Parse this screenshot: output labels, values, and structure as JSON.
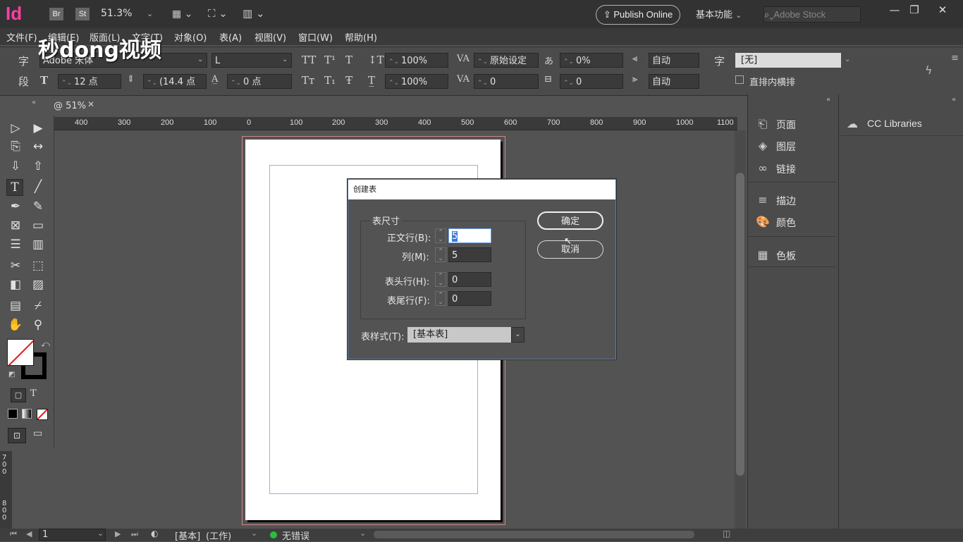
{
  "app": {
    "logo": "Id",
    "bridge_label": "Br",
    "stock_label": "St",
    "zoom": "51.3%",
    "publish_label": "Publish Online",
    "workspace": "基本功能",
    "search_placeholder": "Adobe Stock"
  },
  "menu": [
    "文件(F)",
    "编辑(E)",
    "版面(L)",
    "文字(T)",
    "对象(O)",
    "表(A)",
    "视图(V)",
    "窗口(W)",
    "帮助(H)"
  ],
  "control": {
    "char_label": "字",
    "para_label": "段",
    "font_family": "Adobe 宋体",
    "font_style": "L",
    "font_size": "12 点",
    "leading": "(14.4 点",
    "kerning": "0 点",
    "vscale": "100%",
    "hscale": "100%",
    "tracking_mode": "原始设定",
    "tracking": "0",
    "tsume": "0%",
    "baseline": "0",
    "auto1": "自动",
    "auto2": "自动",
    "char_style_label": "字",
    "char_style": "[无]",
    "tate_label": "直排内横排"
  },
  "tab": {
    "label": "@ 51%"
  },
  "ruler": [
    "400",
    "300",
    "200",
    "100",
    "0",
    "100",
    "200",
    "300",
    "400",
    "500",
    "600",
    "700",
    "800",
    "900",
    "1000",
    "1100"
  ],
  "ruler_left": [
    "700",
    "800"
  ],
  "panels": {
    "left": [
      "页面",
      "图层",
      "链接",
      "描边",
      "颜色",
      "色板"
    ],
    "right": "CC Libraries"
  },
  "dialog": {
    "title": "创建表",
    "group_title": "表尺寸",
    "body_rows_label": "正文行(B):",
    "body_rows": "5",
    "columns_label": "列(M):",
    "columns": "5",
    "header_rows_label": "表头行(H):",
    "header_rows": "0",
    "footer_rows_label": "表尾行(F):",
    "footer_rows": "0",
    "table_style_label": "表样式(T):",
    "table_style": "[基本表]",
    "ok_label": "确定",
    "cancel_label": "取消"
  },
  "status": {
    "page": "1",
    "master": "[基本]",
    "mode": "(工作)",
    "errors": "无错误"
  },
  "watermark": "秒dong视频",
  "colors": {
    "accent": "#ff3ea5",
    "dialog_border": "#4e82c4",
    "ok_dot": "#2dbd3a"
  }
}
